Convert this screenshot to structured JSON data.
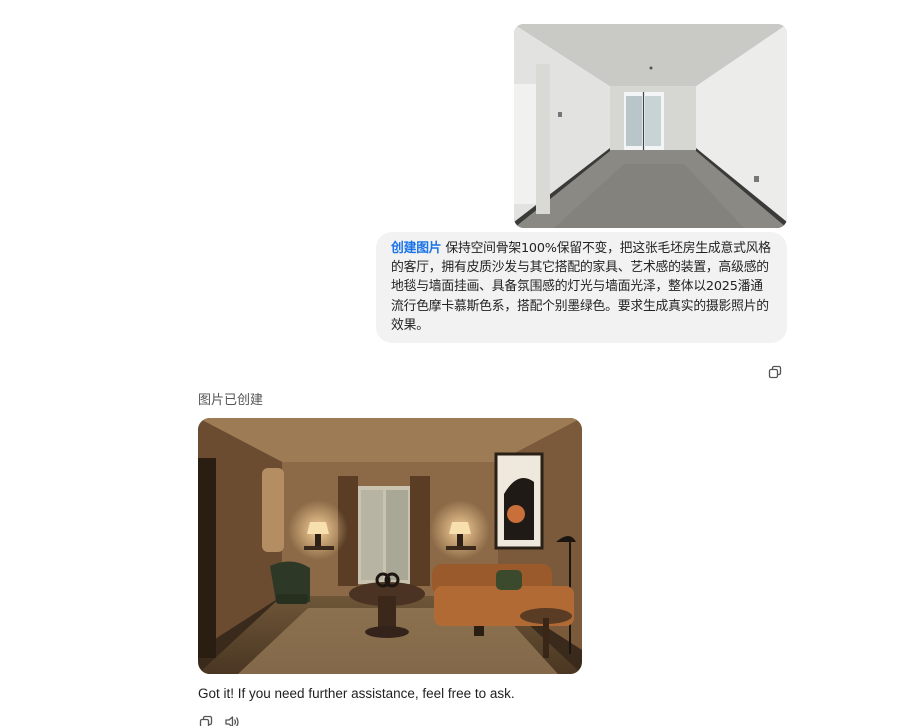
{
  "conversation": {
    "user_message": {
      "tag": "创建图片",
      "text": "保持空间骨架100%保留不变，把这张毛坯房生成意式风格的客厅，拥有皮质沙发与其它搭配的家具、艺术感的装置，高级感的地毯与墙面挂画、具备氛围感的灯光与墙面光泽，整体以2025潘通流行色摩卡慕斯色系，搭配个别墨绿色。要求生成真实的摄影照片的效果。",
      "attachment_icon": "empty-room-photo"
    },
    "assistant": {
      "status": "图片已创建",
      "generated_image": "italian-living-room-photo",
      "reply": "Got it! If you need further assistance, feel free to ask."
    }
  },
  "icons": {
    "copy": "copy-icon",
    "speaker": "speaker-icon"
  },
  "colors": {
    "accent": "#1a73e8",
    "bubble": "#f2f2f3"
  }
}
